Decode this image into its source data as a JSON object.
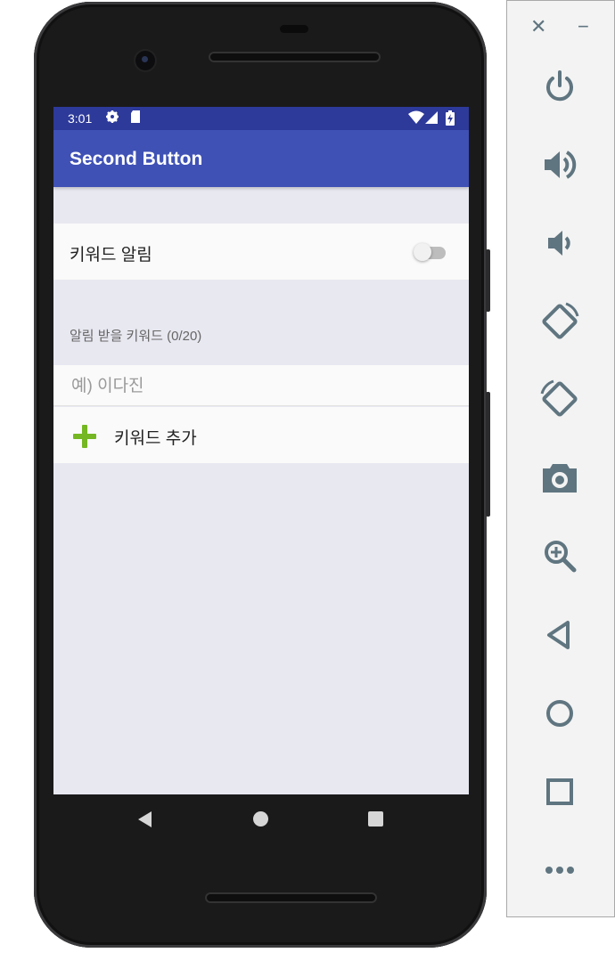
{
  "status_bar": {
    "time": "3:01",
    "icons": [
      "gear-icon",
      "sd-card-icon",
      "wifi-icon",
      "cell-signal-icon",
      "battery-charging-icon"
    ]
  },
  "app_bar": {
    "title": "Second Button"
  },
  "notification_setting": {
    "label": "키워드 알림",
    "toggle_on": false
  },
  "keywords_section": {
    "header": "알림 받을 키워드 (0/20)",
    "input": {
      "value": "",
      "placeholder": "예) 이다진"
    },
    "add_button_label": "키워드 추가"
  },
  "nav_bar": {
    "icons": [
      "back-icon",
      "home-icon",
      "recents-icon"
    ]
  },
  "emulator_panel": {
    "window_controls": {
      "close": "✕",
      "minimize": "−"
    },
    "tools": [
      "power-icon",
      "volume-up-icon",
      "volume-down-icon",
      "rotate-left-icon",
      "rotate-right-icon",
      "camera-icon",
      "zoom-icon",
      "back-icon",
      "home-icon",
      "overview-icon",
      "more-icon"
    ]
  },
  "colors": {
    "status_bar": "#2d3a9a",
    "app_bar": "#3f51b5",
    "screen_bg": "#e8e8f1",
    "accent_plus": "#74b722",
    "panel_icon": "#5f7580"
  }
}
